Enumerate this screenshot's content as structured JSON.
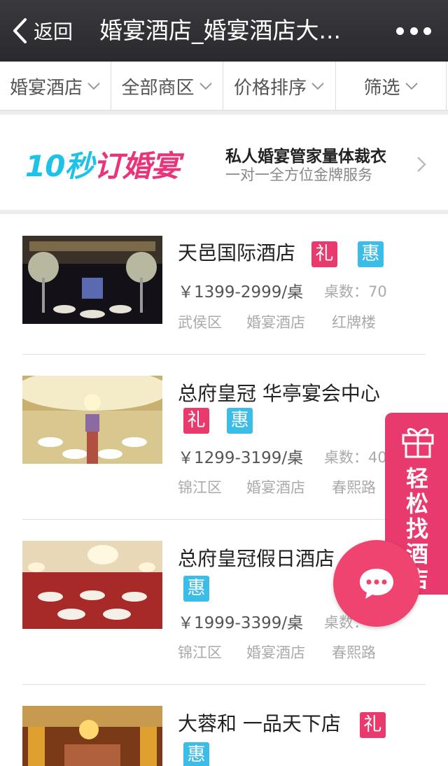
{
  "header": {
    "back_label": "返回",
    "title": "婚宴酒店_婚宴酒店大..."
  },
  "filters": [
    {
      "label": "婚宴酒店"
    },
    {
      "label": "全部商区"
    },
    {
      "label": "价格排序"
    },
    {
      "label": "筛选"
    }
  ],
  "banner": {
    "logo_main": "10秒",
    "logo_accent": "订婚宴",
    "line1": "私人婚宴管家量体裁衣",
    "line2": "一对一全方位金牌服务"
  },
  "tags": {
    "li": "礼",
    "hui": "惠"
  },
  "hotels": [
    {
      "name": "天邑国际酒店",
      "price": "￥1399-2999/桌",
      "tables": "桌数：70",
      "district": "武侯区",
      "category": "婚宴酒店",
      "area": "红牌楼"
    },
    {
      "name": "总府皇冠 华亭宴会中心",
      "price": "￥1299-3199/桌",
      "tables": "桌数：40",
      "district": "锦江区",
      "category": "婚宴酒店",
      "area": "春熙路"
    },
    {
      "name": "总府皇冠假日酒店",
      "price": "￥1999-3399/桌",
      "tables": "桌数：",
      "district": "锦江区",
      "category": "婚宴酒店",
      "area": "春熙路"
    },
    {
      "name": "大蓉和 一品天下店"
    }
  ],
  "side_banner": {
    "text": "轻松找酒店"
  },
  "colors": {
    "header_bg": "#333237",
    "tag_li": "#e93a6e",
    "tag_hui": "#3bbde8",
    "side_banner": "#e93a6e",
    "chat_fab": "#f04470"
  }
}
